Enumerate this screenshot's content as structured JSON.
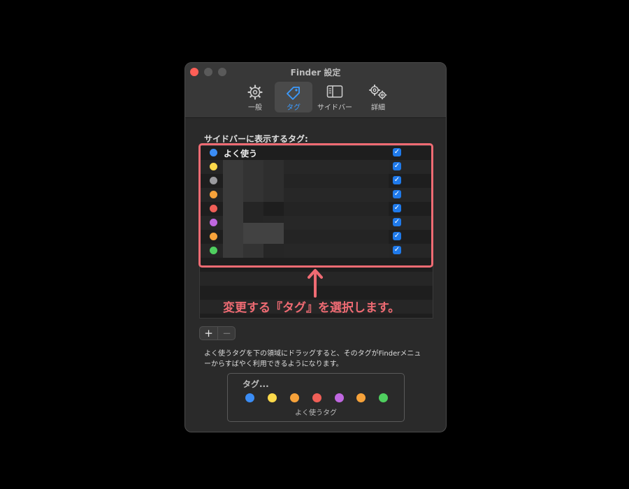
{
  "window": {
    "title": "Finder 設定"
  },
  "toolbar": {
    "tabs": [
      {
        "label": "一般",
        "icon": "gear-icon"
      },
      {
        "label": "タグ",
        "icon": "tag-icon",
        "active": true
      },
      {
        "label": "サイドバー",
        "icon": "sidebar-icon"
      },
      {
        "label": "詳細",
        "icon": "gears-icon"
      }
    ]
  },
  "tags_section": {
    "label": "サイドバーに表示するタグ:",
    "rows": [
      {
        "name": "よく使う",
        "color": "#3b8df5",
        "checked": true
      },
      {
        "name": "",
        "color": "#fcd94a",
        "checked": true
      },
      {
        "name": "",
        "color": "#9a9a9e",
        "checked": true
      },
      {
        "name": "",
        "color": "#f7a23a",
        "checked": true
      },
      {
        "name": "",
        "color": "#f05f57",
        "checked": true
      },
      {
        "name": "",
        "color": "#c067e0",
        "checked": true
      },
      {
        "name": "",
        "color": "#f7a23a",
        "checked": true
      },
      {
        "name": "",
        "color": "#4fcf5f",
        "checked": true
      }
    ]
  },
  "annotation": {
    "text": "変更する『タグ』を選択します。",
    "color": "#ef6b73"
  },
  "buttons": {
    "add": "+",
    "remove": "−"
  },
  "help_text": "よく使うタグを下の領域にドラッグすると、そのタグがFinderメニューからすばやく利用できるようになります。",
  "favorites_drop": {
    "title": "タグ...",
    "label": "よく使うタグ",
    "colors": [
      "#3b8df5",
      "#fcd94a",
      "#f7a23a",
      "#f05f57",
      "#c067e0",
      "#f7a23a",
      "#4fcf5f"
    ]
  },
  "check_glyph": "✓"
}
